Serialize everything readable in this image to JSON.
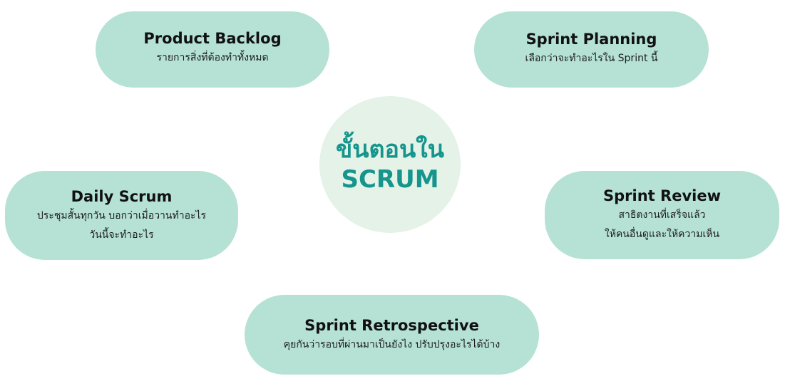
{
  "center": {
    "line1": "ขั้นตอนใน",
    "line2": "SCRUM"
  },
  "steps": {
    "product_backlog": {
      "title": "Product Backlog",
      "description": "รายการสิ่งที่ต้องทำทั้งหมด"
    },
    "sprint_planning": {
      "title": "Sprint Planning",
      "description": "เลือกว่าจะทำอะไรใน Sprint นี้"
    },
    "daily_scrum": {
      "title": "Daily Scrum",
      "description": "ประชุมสั้นทุกวัน บอกว่าเมื่อวานทำอะไร วันนี้จะทำอะไร"
    },
    "sprint_review": {
      "title": "Sprint Review",
      "description_line1": "สาธิตงานที่เสร็จแล้ว",
      "description_line2": "ให้คนอื่นดูและให้ความเห็น"
    },
    "sprint_retrospective": {
      "title": "Sprint Retrospective",
      "description": "คุยกันว่ารอบที่ผ่านมาเป็นยังไง ปรับปรุงอะไรได้บ้าง"
    }
  },
  "colors": {
    "pill_fill": "#b5e2d4",
    "center_fill": "#e5f2e8",
    "center_text": "#16958d"
  }
}
